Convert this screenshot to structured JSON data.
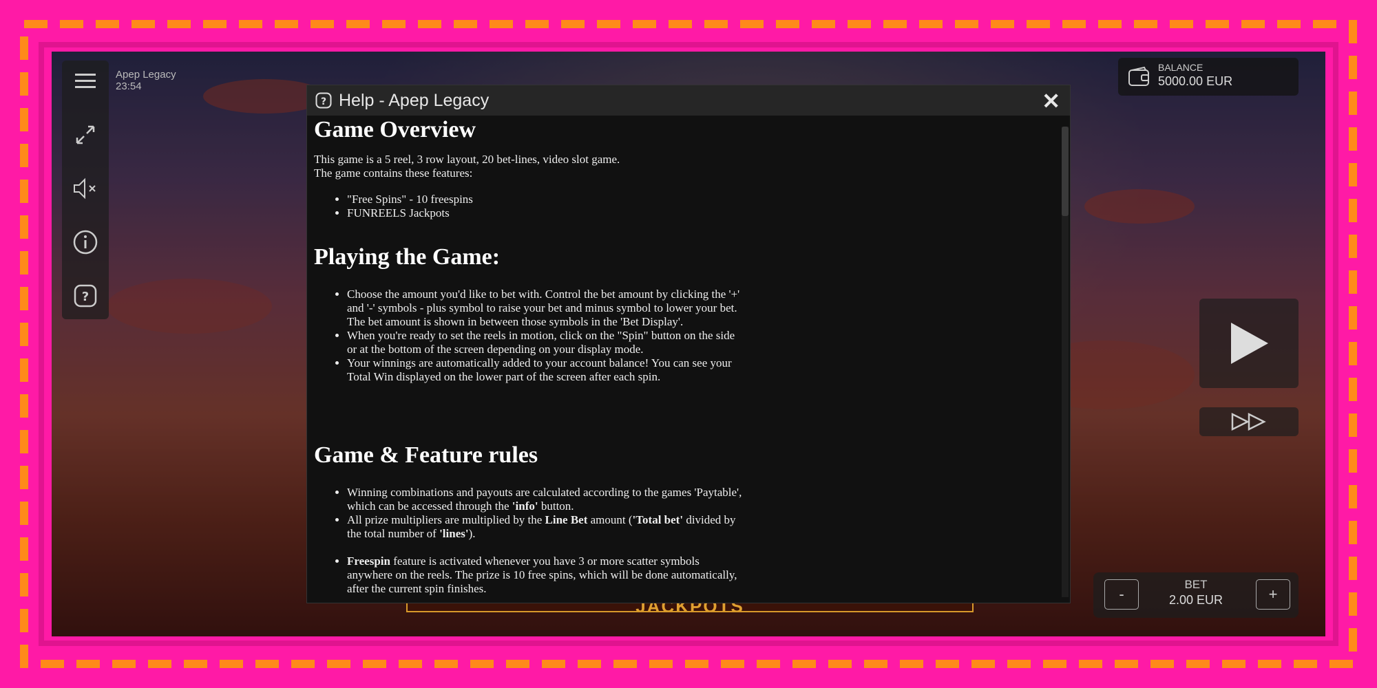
{
  "game": {
    "name": "Apep Legacy",
    "clock": "23:54"
  },
  "balance": {
    "label": "BALANCE",
    "value": "5000.00 EUR"
  },
  "bet": {
    "label": "BET",
    "value": "2.00 EUR",
    "minus": "-",
    "plus": "+"
  },
  "background_banner": "JACKPOTS",
  "sidebar": {
    "icons": [
      "menu-icon",
      "fullscreen-icon",
      "sound-muted-icon",
      "info-icon",
      "help-icon"
    ]
  },
  "modal": {
    "title": "Help - Apep Legacy",
    "close": "✕",
    "sections": {
      "overview": {
        "heading": "Game Overview",
        "line1": "This game is a 5 reel, 3 row layout, 20 bet-lines, video slot game.",
        "line2": "The game contains these features:",
        "features": [
          "\"Free Spins\" - 10 freespins",
          "FUNREELS Jackpots"
        ]
      },
      "playing": {
        "heading": "Playing the Game:",
        "items": [
          "Choose the amount you'd like to bet with. Control the bet amount by clicking the '+' and '-' symbols - plus symbol to raise your bet and minus symbol to lower your bet. The bet amount is shown in between those symbols in the 'Bet Display'.",
          "When you're ready to set the reels in motion, click on the \"Spin\" button on the side or at the bottom of the screen depending on your display mode.",
          "Your winnings are automatically added to your account balance! You can see your Total Win displayed on the lower part of the screen after each spin."
        ]
      },
      "rules": {
        "heading": "Game & Feature rules",
        "item1_pre": "Winning combinations and payouts are calculated according to the games 'Paytable', which can be accessed through the ",
        "item1_bold": "'info'",
        "item1_post": " button.",
        "item2_pre": "All prize multipliers are multiplied by the ",
        "item2_bold1": "Line Bet",
        "item2_mid": " amount (",
        "item2_bold2": "'Total bet'",
        "item2_mid2": " divided by the total number of ",
        "item2_bold3": "'lines'",
        "item2_post": ").",
        "item3_bold": "Freespin",
        "item3_post": " feature is activated whenever you have 3 or more scatter symbols anywhere on the reels. The prize is 10 free spins, which will be done automatically, after the current spin finishes."
      }
    }
  },
  "colors": {
    "frame": "#ff1aa6",
    "dashes": "#ff8a1a",
    "modal_bg": "#111111",
    "modal_header": "#262626"
  }
}
